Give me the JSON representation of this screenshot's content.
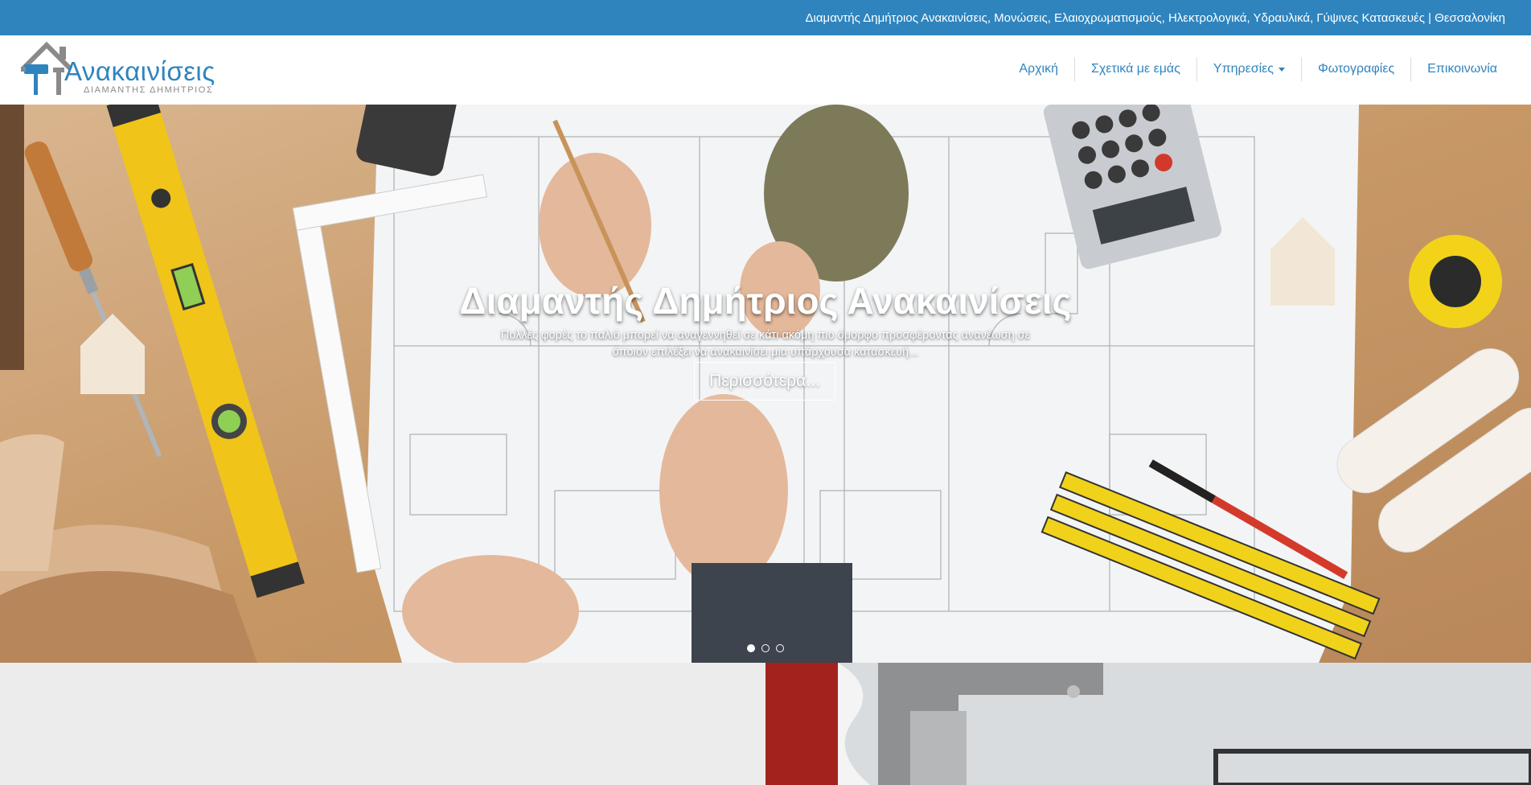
{
  "topbar": {
    "text": "Διαμαντής Δημήτριος Ανακαινίσεις, Μονώσεις, Ελαιοχρωματισμούς, Ηλεκτρολογικά, Υδραυλικά, Γύψινες Κατασκευές | Θεσσαλονίκη"
  },
  "logo": {
    "title": "Ανακαινίσεις",
    "subtitle": "ΔΙΑΜΑΝΤΗΣ ΔΗΜΗΤΡΙΟΣ"
  },
  "nav": {
    "items": [
      {
        "label": "Αρχική"
      },
      {
        "label": "Σχετικά με εμάς"
      },
      {
        "label": "Υπηρεσίες"
      },
      {
        "label": "Φωτογραφίες"
      },
      {
        "label": "Επικοινωνία"
      }
    ]
  },
  "hero": {
    "title": "Διαμαντής Δημήτριος Ανακαινίσεις",
    "text": "Πολλές φορές το παλιό μπορεί να αναγεννηθεί σε κάτι ακόμη πιο όμορφο προσφέροντας ανανέωση σε όποιον επιλέξει να ανακαινίσει μια υπάρχουσα κατασκευή...",
    "button": "Περισσότερα...",
    "slides": 3,
    "active_slide": 1
  },
  "colors": {
    "brand": "#2f84be",
    "topbar_bg": "#2f84be",
    "nav_text": "#2f84be"
  }
}
